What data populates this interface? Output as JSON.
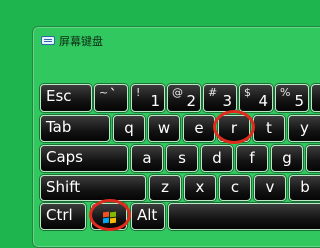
{
  "window": {
    "title": "屏幕键盘",
    "icon": "keyboard-icon"
  },
  "keys": {
    "esc": "Esc",
    "tilde": {
      "upper": "~",
      "lower": "`"
    },
    "one": {
      "upper": "!",
      "lower": "1"
    },
    "two": {
      "upper": "@",
      "lower": "2"
    },
    "three": {
      "upper": "#",
      "lower": "3"
    },
    "four": {
      "upper": "$",
      "lower": "4"
    },
    "five": {
      "upper": "%",
      "lower": "5"
    },
    "tab": "Tab",
    "q": "q",
    "w": "w",
    "e": "e",
    "r": "r",
    "t": "t",
    "y": "y",
    "caps": "Caps",
    "a": "a",
    "s": "s",
    "d": "d",
    "f": "f",
    "g": "g",
    "shift": "Shift",
    "z": "z",
    "x": "x",
    "c": "c",
    "v": "v",
    "b": "b",
    "ctrl": "Ctrl",
    "win": "windows-logo-icon",
    "alt": "Alt"
  },
  "highlights": [
    "r",
    "windows"
  ],
  "colors": {
    "background": "#1fb54e",
    "window": "#31c95f",
    "key": "#131313",
    "highlight": "#e02a1e"
  }
}
